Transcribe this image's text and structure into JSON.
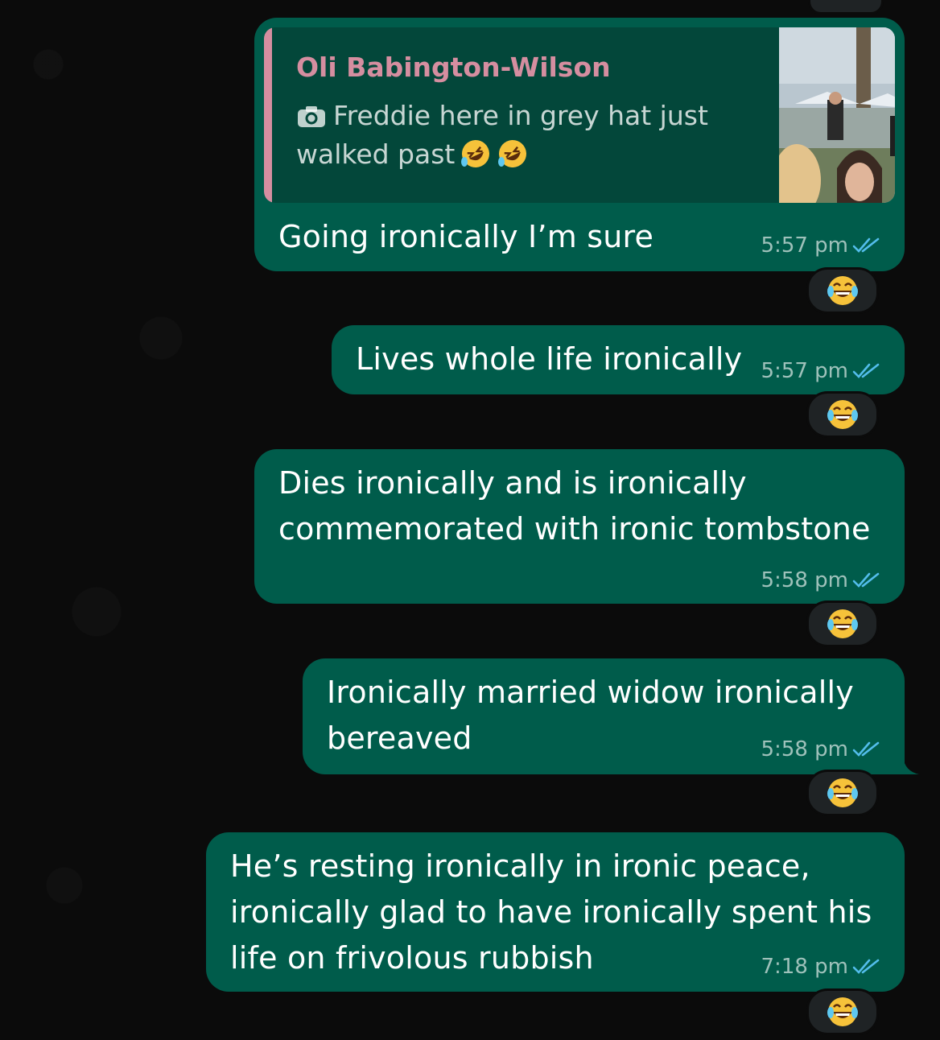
{
  "chat": {
    "messages": [
      {
        "quote": {
          "author": "Oli Babington-Wilson",
          "icon": "camera-icon",
          "text": "Freddie here in grey hat just walked past",
          "emoji": [
            "🤣",
            "🤣"
          ]
        },
        "text": "Going ironically I’m sure",
        "time": "5:57 pm",
        "status": "read",
        "reaction": "😂"
      },
      {
        "text": "Lives whole life ironically",
        "time": "5:57 pm",
        "status": "read",
        "reaction": "😂"
      },
      {
        "text": "Dies ironically and is ironically commemorated with ironic tombstone",
        "time": "5:58 pm",
        "status": "read",
        "reaction": "😂"
      },
      {
        "text": "Ironically married widow ironically bereaved",
        "time": "5:58 pm",
        "status": "read",
        "reaction": "😂"
      },
      {
        "text": "He’s resting ironically in ironic peace, ironically glad to have ironically spent his life on frivolous rubbish",
        "time": "7:18 pm",
        "status": "read",
        "reaction": "😂"
      }
    ]
  },
  "colors": {
    "outgoing_bubble": "#005c4b",
    "quote_background": "#03473a",
    "quote_accent": "#d58ea0",
    "read_ticks": "#53bdeb",
    "reaction_background": "#1f2325",
    "background": "#0b0b0b"
  }
}
